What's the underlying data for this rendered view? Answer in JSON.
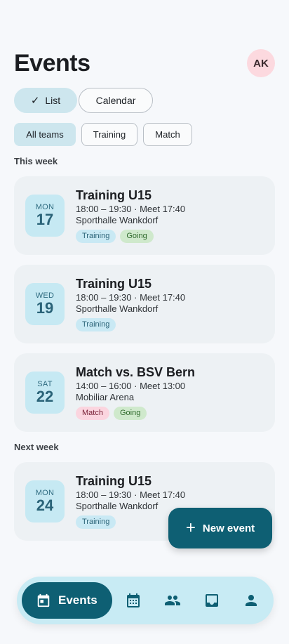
{
  "header": {
    "title": "Events",
    "avatar_initials": "AK"
  },
  "view_toggle": {
    "list_check": "✓",
    "list_label": "List",
    "calendar_label": "Calendar"
  },
  "filters": {
    "all": "All teams",
    "training": "Training",
    "match": "Match"
  },
  "sections": {
    "this_week": "This week",
    "next_week": "Next week"
  },
  "events": [
    {
      "dow": "MON",
      "day": "17",
      "title": "Training U15",
      "time": "18:00 – 19:30 · Meet 17:40",
      "place": "Sporthalle Wankdorf",
      "tags": [
        "Training",
        "Going"
      ]
    },
    {
      "dow": "WED",
      "day": "19",
      "title": "Training U15",
      "time": "18:00 – 19:30 · Meet 17:40",
      "place": "Sporthalle Wankdorf",
      "tags": [
        "Training"
      ]
    },
    {
      "dow": "SAT",
      "day": "22",
      "title": "Match vs. BSV Bern",
      "time": "14:00 – 16:00 · Meet 13:00",
      "place": "Mobiliar Arena",
      "tags": [
        "Match",
        "Going"
      ]
    },
    {
      "dow": "MON",
      "day": "24",
      "title": "Training U15",
      "time": "18:00 – 19:30 · Meet 17:40",
      "place": "Sporthalle Wankdorf",
      "tags": [
        "Training"
      ]
    }
  ],
  "fab": {
    "plus": "+",
    "label": "New event"
  },
  "nav": {
    "events_label": "Events",
    "icons": [
      "events-icon",
      "calendar-icon",
      "team-icon",
      "inbox-icon",
      "profile-icon"
    ]
  },
  "colors": {
    "primary": "#0e5f73",
    "accent_light": "#cde6ee",
    "nav_bg": "#c8ebf4"
  }
}
